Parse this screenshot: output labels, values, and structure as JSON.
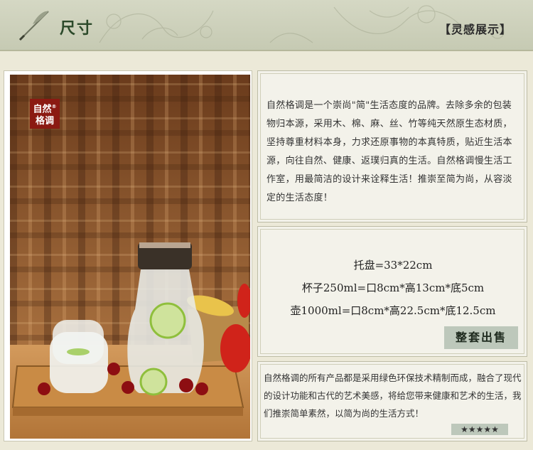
{
  "header": {
    "title": "尺寸",
    "tagline": "【灵感展示】"
  },
  "photo": {
    "brand_logo_line1": "自然",
    "brand_logo_line2": "格调",
    "brand_logo_mark": "®"
  },
  "intro": {
    "text": "自然格调是一个崇尚\"简\"生活态度的品牌。去除多余的包装物归本源，采用木、棉、麻、丝、竹等纯天然原生态材质，坚持尊重材料本身，力求还原事物的本真特质，贴近生活本源，向往自然、健康、返璞归真的生活。自然格调慢生活工作室，用最简洁的设计来诠释生活！推崇至简为尚，从容淡定的生活态度！"
  },
  "specs": {
    "tray": "托盘=33*22cm",
    "cup": "杯子250ml=口8cm*高13cm*底5cm",
    "pot": "壶1000ml=口8cm*高22.5cm*底12.5cm",
    "buy_label": "整套出售"
  },
  "description": {
    "text": "自然格调的所有产品都是采用绿色环保技术精制而成，融合了现代的设计功能和古代的艺术美感，将给您带来健康和艺术的生活，我们推崇简单素然，以简为尚的生活方式！",
    "stars": "★★★★★"
  },
  "colors": {
    "header_bg": "#c6cab3",
    "title": "#2c4a2a",
    "logo": "#8b1a12",
    "button": "#bdc8bb"
  }
}
